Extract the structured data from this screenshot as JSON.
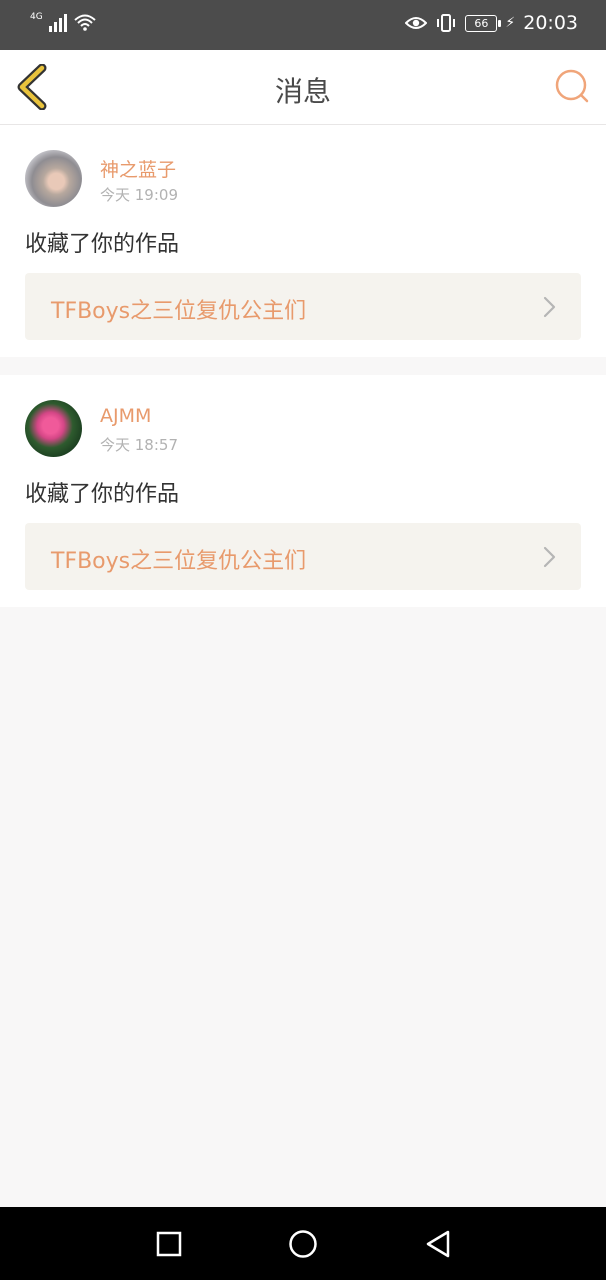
{
  "status_bar": {
    "network": "4G",
    "battery": "66",
    "time": "20:03"
  },
  "header": {
    "title": "消息"
  },
  "messages": [
    {
      "username": "神之蓝子",
      "time": "今天 19:09",
      "action": "收藏了你的作品",
      "work_title": "TFBoys之三位复仇公主们"
    },
    {
      "username": "AJMM",
      "time": "今天 18:57",
      "action": "收藏了你的作品",
      "work_title": "TFBoys之三位复仇公主们"
    }
  ],
  "colors": {
    "accent": "#e89a6c",
    "back_icon": "#e9c33c",
    "status_bar_bg": "#4c4c4c",
    "page_bg": "#f8f7f7"
  },
  "icons": {
    "back": "chevron-left-icon",
    "search": "search-icon",
    "link_chevron": "chevron-right-icon"
  }
}
